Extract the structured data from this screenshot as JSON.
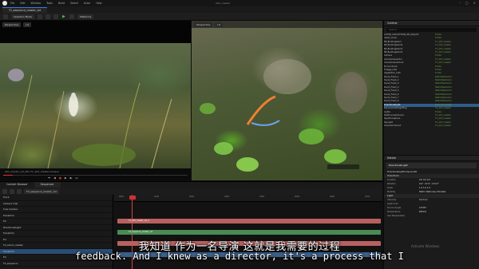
{
  "window": {
    "title": "ASU_master",
    "tab": "T2_sequence_master_vid",
    "menu": [
      "File",
      "Edit",
      "Window",
      "Tools",
      "Build",
      "Select",
      "Actor",
      "Help"
    ]
  },
  "toolbar": {
    "mode": "Selection Mode",
    "platforms": "Platforms"
  },
  "viewport_left": {
    "perspective": "Perspective",
    "lit": "Lit",
    "clip_label": "A01_master_vid_001  T1_A03_master/camera",
    "clip_right": "[Viewport(Locked] Jun Fitten [Slate Camera 03:11]",
    "progress": 0.05
  },
  "viewport_right": {
    "perspective": "Perspective",
    "lit": "Lit",
    "overlay_text": "actor label shown"
  },
  "outliner": {
    "title": "Outliner",
    "search_placeholder": "Search...",
    "rows": [
      {
        "name": "ACTOR_COLLECTION_OB_ObjectV",
        "type": "Folder",
        "sel": false
      },
      {
        "name": "Asset_scene",
        "type": "Folder",
        "sel": false
      },
      {
        "name": "BP_Buildingstem",
        "type": "T1_A03_master",
        "sel": false
      },
      {
        "name": "BP_Buildingstem2",
        "type": "T1_A03_master",
        "sel": false
      },
      {
        "name": "BP_Buildingstem3",
        "type": "T1_A03_master",
        "sel": false
      },
      {
        "name": "BP_Buildingstem4",
        "type": "T1_A03_master",
        "sel": false
      },
      {
        "name": "Camera",
        "type": "Folder",
        "sel": false
      },
      {
        "name": "CineCameraActor",
        "type": "T1_A03_master",
        "sel": false
      },
      {
        "name": "CineCameraActor2",
        "type": "T1_A03_master",
        "sel": false
      },
      {
        "name": "Environment",
        "type": "Folder",
        "sel": false
      },
      {
        "name": "Foliage_LOD",
        "type": "Folder",
        "sel": false
      },
      {
        "name": "Vegetation_LOD",
        "type": "Folder",
        "sel": false
      },
      {
        "name": "Decal_Fresh_1",
        "type": "StaticMeshActor",
        "sel": false
      },
      {
        "name": "Decal_Fresh_2",
        "type": "StaticMeshActor",
        "sel": false
      },
      {
        "name": "Decal_Fresh_3",
        "type": "StaticMeshActor",
        "sel": false
      },
      {
        "name": "Decal_Fresh_4",
        "type": "StaticMeshActor",
        "sel": false
      },
      {
        "name": "Decal_Fresh_5",
        "type": "StaticMeshActor",
        "sel": false
      },
      {
        "name": "Decal_Fresh_6",
        "type": "StaticMeshActor",
        "sel": false
      },
      {
        "name": "Decal_Fresh_7",
        "type": "StaticMeshActor",
        "sel": false
      },
      {
        "name": "Decal_Fresh_8",
        "type": "StaticMeshActor",
        "sel": false
      },
      {
        "name": "DirectionalLight",
        "type": "DirectionalLight",
        "sel": true
      },
      {
        "name": "ExponentialHeightFog",
        "type": "T1_A03_master",
        "sel": false
      },
      {
        "name": "Lights",
        "type": "Folder",
        "sel": false
      },
      {
        "name": "PostProcessVolume",
        "type": "T1_A03_master",
        "sel": false
      },
      {
        "name": "SkyAtmosphere",
        "type": "T1_A03_master",
        "sel": false
      },
      {
        "name": "SkyLight",
        "type": "T1_A03_master",
        "sel": false
      },
      {
        "name": "VolumetricCloud",
        "type": "T1_A03_master",
        "sel": false
      }
    ],
    "footer": "1094 actors (1 selected)"
  },
  "details": {
    "title": "Details",
    "selected": "DirectionalLight",
    "component": "DirectionalLightComponent0",
    "rows": [
      {
        "label": "Transform",
        "value": "",
        "section": true
      },
      {
        "label": "Location",
        "value": "0.0   0.0   0.0",
        "section": false
      },
      {
        "label": "Rotation",
        "value": "0.0°  -47.0°  -115.0°",
        "section": false
      },
      {
        "label": "Scale",
        "value": "1.0   1.0   1.0",
        "section": false
      },
      {
        "label": "Mobility",
        "value": "Static  Stationary  Movable",
        "section": false
      },
      {
        "label": "Light",
        "value": "",
        "section": true
      },
      {
        "label": "Intensity",
        "value": "10.0 lux",
        "section": false
      },
      {
        "label": "Light Color",
        "value": "",
        "section": false
      },
      {
        "label": "Source Angle",
        "value": "0.5357",
        "section": false
      },
      {
        "label": "Temperature",
        "value": "6500.0",
        "section": false
      },
      {
        "label": "Use Temperature",
        "value": "",
        "section": false
      }
    ]
  },
  "sequencer": {
    "tabs": [
      "Content Browser",
      "Sequencer"
    ],
    "sequence_name": "T2_sequence_master_vid",
    "tracks": [
      {
        "label": "Track",
        "sel": false
      },
      {
        "label": "Camera Cuts",
        "sel": false
      },
      {
        "label": "Cine Camera",
        "sel": false
      },
      {
        "label": "Transform",
        "sel": false
      },
      {
        "label": "Fol",
        "sel": false
      },
      {
        "label": "DirectionalLight",
        "sel": false
      },
      {
        "label": "Transform",
        "sel": false
      },
      {
        "label": "Fol",
        "sel": false
      },
      {
        "label": "T2_actors_master",
        "sel": false
      },
      {
        "label": "Transform",
        "sel": true
      },
      {
        "label": "Fol",
        "sel": false
      },
      {
        "label": "T2_sequence",
        "sel": false
      }
    ],
    "ruler": [
      "0000",
      "0100",
      "0200",
      "0300",
      "0400",
      "0500",
      "0600",
      "0700"
    ],
    "bars": [
      {
        "label": "T1_A03_master_vid_1",
        "color": "red"
      },
      {
        "label": "T2_sequence_master_vid",
        "color": "green"
      }
    ],
    "frame": "0034"
  },
  "subtitles": {
    "cn": "我知道 作为一名导演 这就是我需要的过程",
    "en": "feedback. And I knew as a director, it's a process that I"
  },
  "watermark": "Activate Windows",
  "colors": {
    "accent": "#3a7bd5",
    "selection": "#2f5d8a",
    "playhead": "#e04040"
  }
}
